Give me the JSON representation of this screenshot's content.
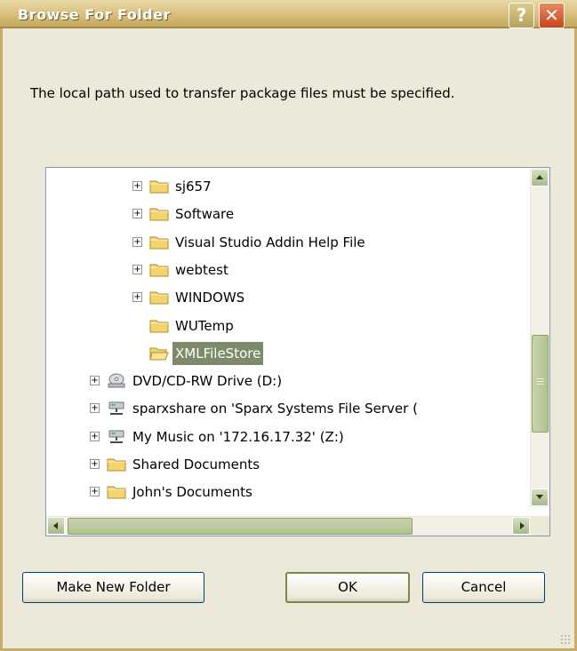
{
  "window": {
    "title": "Browse For Folder",
    "help_label": "?",
    "close_label": "✕"
  },
  "instruction": "The local path used to transfer package files must be specified.",
  "tree": {
    "items": [
      {
        "label": "sj657",
        "icon": "folder-icon",
        "expandable": true,
        "selected": false
      },
      {
        "label": "Software",
        "icon": "folder-icon",
        "expandable": true,
        "selected": false
      },
      {
        "label": "Visual Studio Addin Help File",
        "icon": "folder-icon",
        "expandable": true,
        "selected": false
      },
      {
        "label": "webtest",
        "icon": "folder-icon",
        "expandable": true,
        "selected": false
      },
      {
        "label": "WINDOWS",
        "icon": "folder-icon",
        "expandable": true,
        "selected": false
      },
      {
        "label": "WUTemp",
        "icon": "folder-icon",
        "expandable": false,
        "selected": false
      },
      {
        "label": "XMLFileStore",
        "icon": "open-folder-icon",
        "expandable": false,
        "selected": true
      },
      {
        "label": "DVD/CD-RW Drive (D:)",
        "icon": "dvd-drive-icon",
        "expandable": true,
        "selected": false
      },
      {
        "label": "sparxshare on 'Sparx Systems File Server (",
        "icon": "network-drive-icon",
        "expandable": true,
        "selected": false
      },
      {
        "label": "My Music on '172.16.17.32' (Z:)",
        "icon": "network-drive-icon",
        "expandable": true,
        "selected": false
      },
      {
        "label": "Shared Documents",
        "icon": "folder-icon",
        "expandable": true,
        "selected": false
      },
      {
        "label": "John's Documents",
        "icon": "folder-icon",
        "expandable": true,
        "selected": false
      }
    ]
  },
  "buttons": {
    "new_folder": "Make New Folder",
    "ok": "OK",
    "cancel": "Cancel"
  },
  "colors": {
    "selection": "#7d8b6b",
    "title_bar": "#d9c17f"
  }
}
